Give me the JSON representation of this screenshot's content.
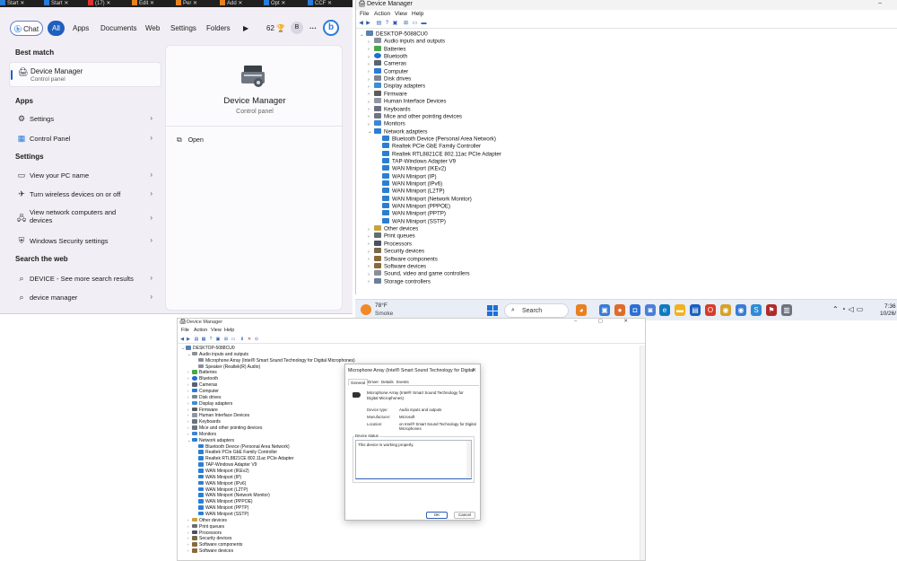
{
  "top_tabs": [
    "Start",
    "Start",
    "(17)",
    "Edit",
    "Per",
    "Add",
    "Opt",
    "CCF"
  ],
  "start_menu": {
    "filters": {
      "chat": "Chat",
      "all": "All",
      "apps": "Apps",
      "documents": "Documents",
      "web": "Web",
      "settings": "Settings",
      "folders": "Folders",
      "play": "▶",
      "score": "62",
      "avatar": "B",
      "more": "···",
      "bing": "b"
    },
    "best_match_heading": "Best match",
    "best_match": {
      "title": "Device Manager",
      "subtitle": "Control panel"
    },
    "apps_heading": "Apps",
    "apps": [
      {
        "label": "Settings",
        "icon": "settings-gear-icon"
      },
      {
        "label": "Control Panel",
        "icon": "control-panel-icon"
      }
    ],
    "settings_heading": "Settings",
    "settings": [
      {
        "label": "View your PC name",
        "icon": "pc-name-icon"
      },
      {
        "label": "Turn wireless devices on or off",
        "icon": "wireless-icon"
      },
      {
        "label": "View network computers and devices",
        "icon": "network-computers-icon"
      },
      {
        "label": "Windows Security settings",
        "icon": "shield-icon"
      }
    ],
    "web_heading": "Search the web",
    "web": [
      {
        "label": "DEVICE - See more search results",
        "icon": "search-icon"
      },
      {
        "label": "device manager",
        "icon": "search-icon"
      }
    ],
    "detail": {
      "title": "Device Manager",
      "subtitle": "Control panel",
      "open_label": "Open"
    }
  },
  "dm_top": {
    "title": "Device Manager",
    "menu": [
      "File",
      "Action",
      "View",
      "Help"
    ],
    "root": "DESKTOP-5088CU0",
    "categories_before": [
      {
        "label": "Audio inputs and outputs",
        "cls": "c-audio"
      },
      {
        "label": "Batteries",
        "cls": "c-battery"
      },
      {
        "label": "Bluetooth",
        "cls": "c-bt"
      },
      {
        "label": "Cameras",
        "cls": "c-camera"
      },
      {
        "label": "Computer",
        "cls": "c-computer"
      },
      {
        "label": "Disk drives",
        "cls": "c-disk"
      },
      {
        "label": "Display adapters",
        "cls": "c-display"
      },
      {
        "label": "Firmware",
        "cls": "c-firmware"
      },
      {
        "label": "Human Interface Devices",
        "cls": "c-hid"
      },
      {
        "label": "Keyboards",
        "cls": "c-keyboard"
      },
      {
        "label": "Mice and other pointing devices",
        "cls": "c-mouse"
      },
      {
        "label": "Monitors",
        "cls": "c-monitor"
      }
    ],
    "network_label": "Network adapters",
    "network_children": [
      "Bluetooth Device (Personal Area Network)",
      "Realtek PCIe GbE Family Controller",
      "Realtek RTL8821CE 802.11ac PCIe Adapter",
      "TAP-Windows Adapter V9",
      "WAN Miniport (IKEv2)",
      "WAN Miniport (IP)",
      "WAN Miniport (IPv6)",
      "WAN Miniport (L2TP)",
      "WAN Miniport (Network Monitor)",
      "WAN Miniport (PPPOE)",
      "WAN Miniport (PPTP)",
      "WAN Miniport (SSTP)"
    ],
    "categories_after": [
      {
        "label": "Other devices",
        "cls": "c-other"
      },
      {
        "label": "Print queues",
        "cls": "c-print"
      },
      {
        "label": "Processors",
        "cls": "c-proc"
      },
      {
        "label": "Security devices",
        "cls": "c-sec"
      },
      {
        "label": "Software components",
        "cls": "c-soft"
      },
      {
        "label": "Software devices",
        "cls": "c-soft"
      },
      {
        "label": "Sound, video and game controllers",
        "cls": "c-sound"
      },
      {
        "label": "Storage controllers",
        "cls": "c-storage"
      }
    ]
  },
  "taskbar": {
    "temp": "78°F",
    "weather": "Smoke",
    "search": "Search",
    "time": "7:36",
    "date": "10/26/"
  },
  "dm_bottom": {
    "title": "Device Manager",
    "menu": [
      "File",
      "Action",
      "View",
      "Help"
    ],
    "root": "DESKTOP-5088CU0",
    "audio_label": "Audio inputs and outputs",
    "audio_children": [
      "Microphone Array (Intel® Smart Sound Technology for Digital Microphones)",
      "Speaker (Realtek(R) Audio)"
    ],
    "categories_before": [
      {
        "label": "Batteries",
        "cls": "c-battery"
      },
      {
        "label": "Bluetooth",
        "cls": "c-bt"
      },
      {
        "label": "Cameras",
        "cls": "c-camera"
      },
      {
        "label": "Computer",
        "cls": "c-computer"
      },
      {
        "label": "Disk drives",
        "cls": "c-disk"
      },
      {
        "label": "Display adapters",
        "cls": "c-display"
      },
      {
        "label": "Firmware",
        "cls": "c-firmware"
      },
      {
        "label": "Human Interface Devices",
        "cls": "c-hid"
      },
      {
        "label": "Keyboards",
        "cls": "c-keyboard"
      },
      {
        "label": "Mice and other pointing devices",
        "cls": "c-mouse"
      },
      {
        "label": "Monitors",
        "cls": "c-monitor"
      }
    ],
    "network_label": "Network adapters",
    "network_children": [
      "Bluetooth Device (Personal Area Network)",
      "Realtek PCIe GbE Family Controller",
      "Realtek RTL8821CE 802.11ac PCIe Adapter",
      "TAP-Windows Adapter V9",
      "WAN Miniport (IKEv2)",
      "WAN Miniport (IP)",
      "WAN Miniport (IPv6)",
      "WAN Miniport (L2TP)",
      "WAN Miniport (Network Monitor)",
      "WAN Miniport (PPPOE)",
      "WAN Miniport (PPTP)",
      "WAN Miniport (SSTP)"
    ],
    "categories_after": [
      {
        "label": "Other devices",
        "cls": "c-other"
      },
      {
        "label": "Print queues",
        "cls": "c-print"
      },
      {
        "label": "Processors",
        "cls": "c-proc"
      },
      {
        "label": "Security devices",
        "cls": "c-sec"
      },
      {
        "label": "Software components",
        "cls": "c-soft"
      },
      {
        "label": "Software devices",
        "cls": "c-soft"
      }
    ]
  },
  "properties": {
    "title": "Microphone Array (Intel® Smart Sound Technology for Digital Mi...",
    "tabs": [
      "General",
      "Driver",
      "Details",
      "Events"
    ],
    "device_name": "Microphone Array (Intel® Smart Sound Technology for Digital Microphones)",
    "device_type_key": "Device type:",
    "device_type": "Audio inputs and outputs",
    "manufacturer_key": "Manufacturer:",
    "manufacturer": "Microsoft",
    "location_key": "Location:",
    "location": "on Intel® Smart Sound Technology for Digital Microphones",
    "status_legend": "Device status",
    "status": "This device is working properly.",
    "ok": "OK",
    "cancel": "Cancel"
  }
}
